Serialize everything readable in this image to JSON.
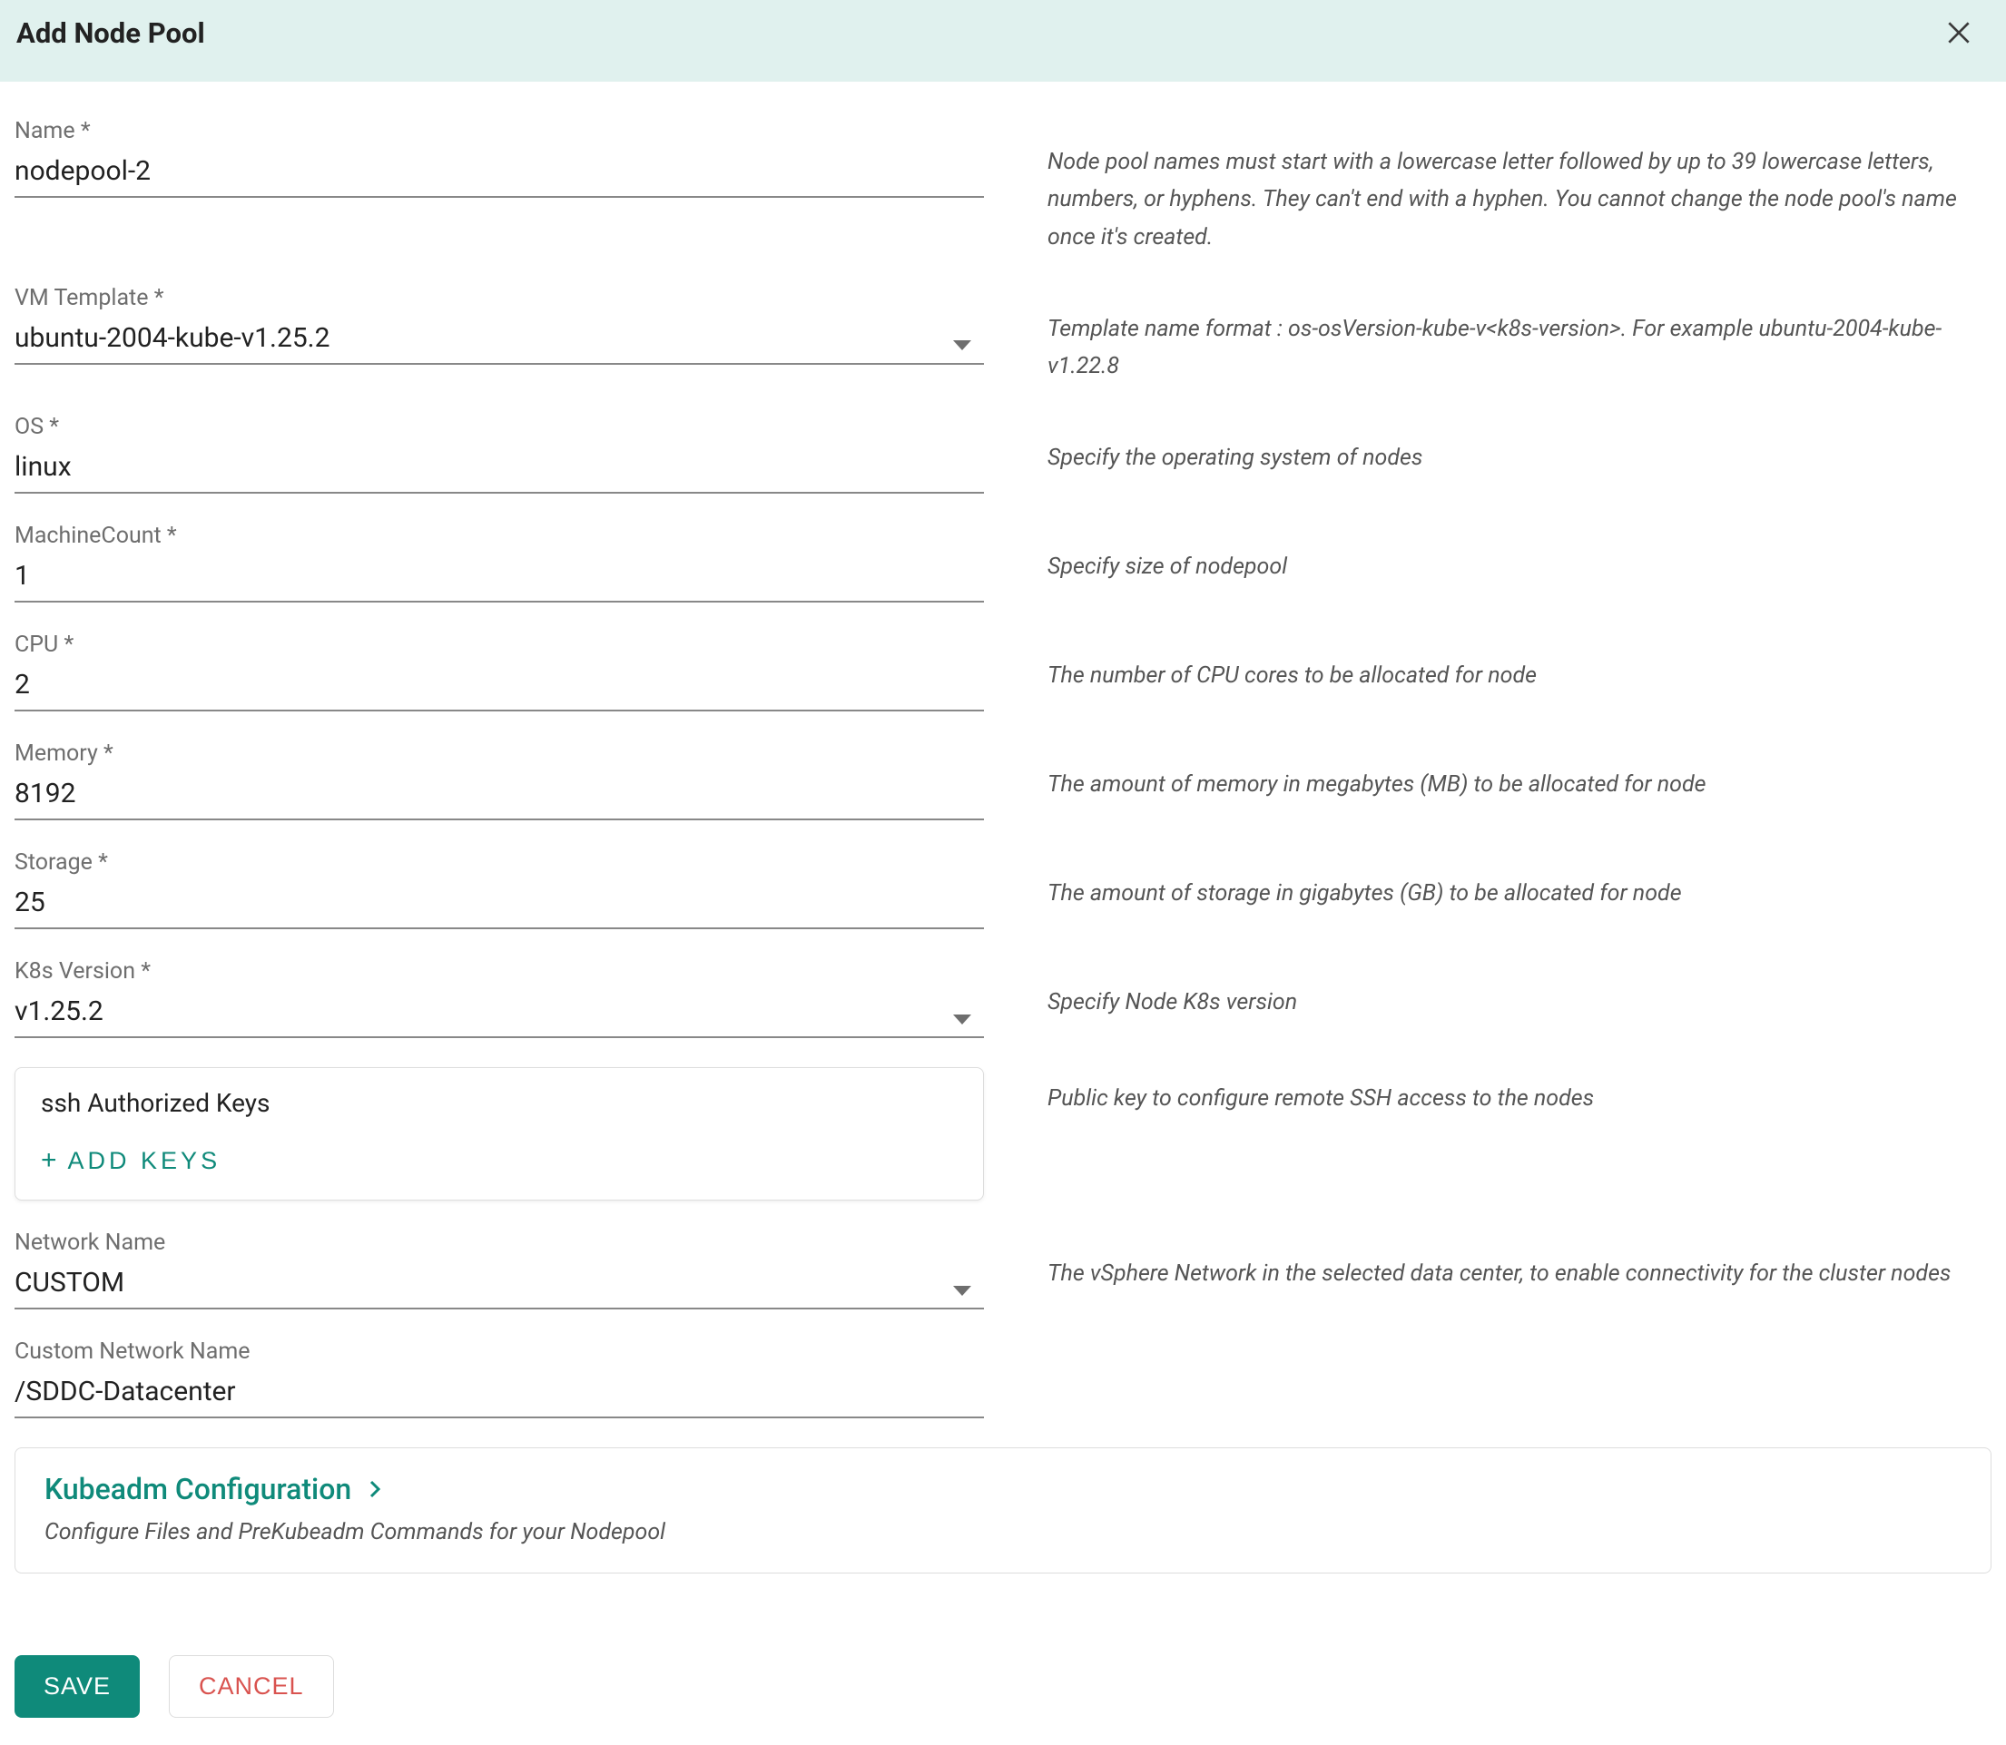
{
  "header": {
    "title": "Add Node Pool"
  },
  "fields": {
    "name": {
      "label": "Name *",
      "value": "nodepool-2",
      "help": "Node pool names must start with a lowercase letter followed by up to 39 lowercase letters, numbers, or hyphens. They can't end with a hyphen. You cannot change the node pool's name once it's created."
    },
    "vm_template": {
      "label": "VM Template *",
      "value": "ubuntu-2004-kube-v1.25.2",
      "help": "Template name format : os-osVersion-kube-v<k8s-version>. For example ubuntu-2004-kube-v1.22.8"
    },
    "os": {
      "label": "OS *",
      "value": "linux",
      "help": "Specify the operating system of nodes"
    },
    "machine_count": {
      "label": "MachineCount *",
      "value": "1",
      "help": "Specify size of nodepool"
    },
    "cpu": {
      "label": "CPU *",
      "value": "2",
      "help": "The number of CPU cores to be allocated for node"
    },
    "memory": {
      "label": "Memory *",
      "value": "8192",
      "help": "The amount of memory in megabytes (MB) to be allocated for node"
    },
    "storage": {
      "label": "Storage *",
      "value": "25",
      "help": "The amount of storage in gigabytes (GB) to be allocated for node"
    },
    "k8s_version": {
      "label": "K8s Version *",
      "value": "v1.25.2",
      "help": "Specify Node K8s version"
    },
    "ssh": {
      "title": "ssh Authorized Keys",
      "add_label": "ADD  KEYS",
      "help": "Public key to configure remote SSH access to the nodes"
    },
    "network_name": {
      "label": "Network Name",
      "value": "CUSTOM",
      "help": "The vSphere Network in the selected data center, to enable connectivity for the cluster nodes"
    },
    "custom_network": {
      "label": "Custom Network Name",
      "value": "/SDDC-Datacenter",
      "help": ""
    }
  },
  "kubeadm": {
    "title": "Kubeadm Configuration",
    "desc": "Configure Files and PreKubeadm Commands for your Nodepool"
  },
  "footer": {
    "save": "SAVE",
    "cancel": "CANCEL"
  }
}
